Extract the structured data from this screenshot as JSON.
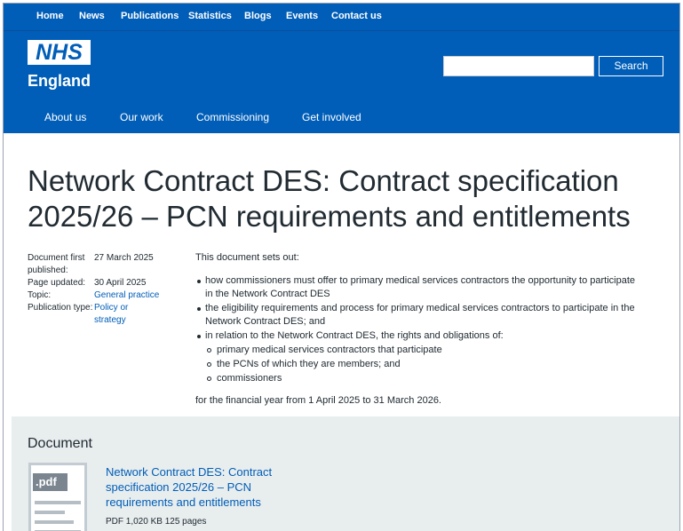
{
  "topnav": {
    "items": [
      {
        "label": "Home"
      },
      {
        "label": "News"
      },
      {
        "label": "Publications"
      },
      {
        "label": "Statistics"
      },
      {
        "label": "Blogs"
      },
      {
        "label": "Events"
      },
      {
        "label": "Contact us"
      }
    ]
  },
  "header": {
    "logo_text": "NHS",
    "logo_sub": "England",
    "search_placeholder": "",
    "search_button": "Search"
  },
  "mainnav": {
    "items": [
      {
        "label": "About us"
      },
      {
        "label": "Our work"
      },
      {
        "label": "Commissioning"
      },
      {
        "label": "Get involved"
      }
    ]
  },
  "page": {
    "title_line1": "Network Contract DES: Contract specification",
    "title_line2": "2025/26 – PCN requirements and entitlements"
  },
  "meta": {
    "first_published_label_1": "Document first",
    "first_published_label_2": "published:",
    "first_published_value": "27 March 2025",
    "updated_label": "Page updated:",
    "updated_value": "30 April 2025",
    "topic_label": "Topic:",
    "topic_value": "General practice",
    "type_label": "Publication type:",
    "type_value_1": "Policy or",
    "type_value_2": "strategy"
  },
  "content": {
    "intro": "This document sets out:",
    "b1_l1": "how commissioners must offer to primary medical services contractors the opportunity to participate",
    "b1_l2": "in the Network Contract DES",
    "b2_l1": "the eligibility requirements and process for primary medical services contractors to participate in the",
    "b2_l2": "Network Contract DES; and",
    "b3": "in relation to the Network Contract DES, the rights and obligations of:",
    "s1": "primary medical services contractors that participate",
    "s2": "the PCNs of which they are members; and",
    "s3": "commissioners",
    "outro": "for the financial year from 1 April 2025 to 31 March 2026."
  },
  "document": {
    "heading": "Document",
    "thumb_label": ".pdf",
    "link_l1": "Network Contract DES: Contract",
    "link_l2": "specification 2025/26 – PCN",
    "link_l3": "requirements and entitlements",
    "info": "PDF 1,020 KB 125 pages"
  }
}
